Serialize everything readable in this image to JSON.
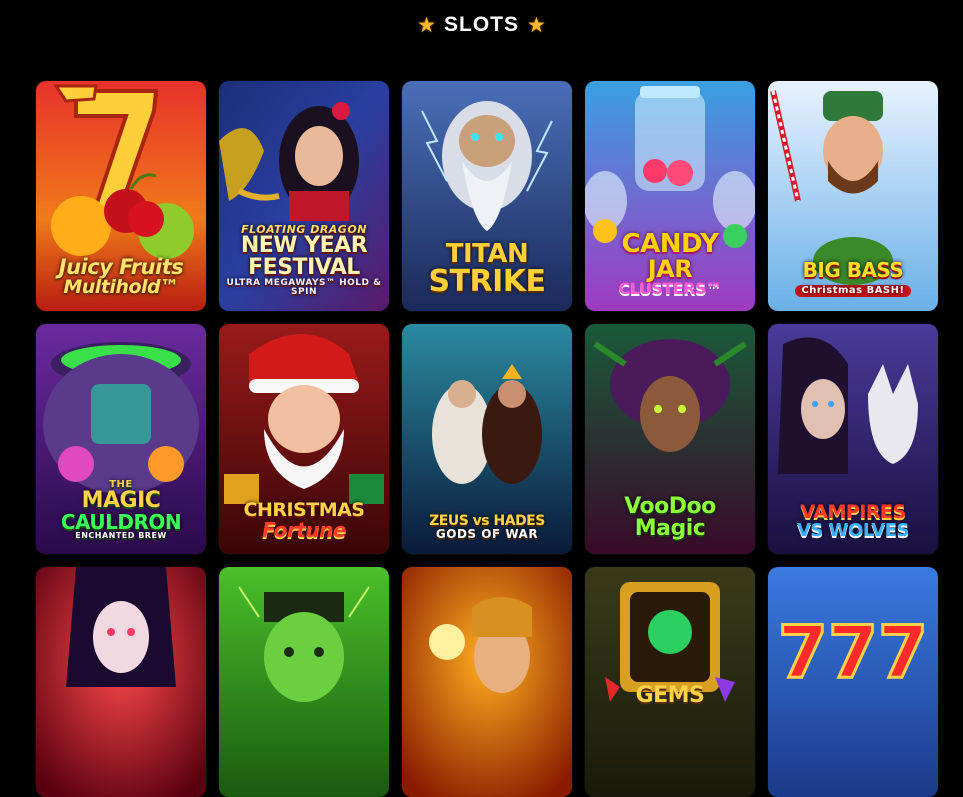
{
  "header": {
    "title": "SLOTS",
    "star_color": "#f5b731"
  },
  "games": [
    {
      "name": "juicy-fruits-multihold",
      "logo": [
        "",
        "Juicy Fruits",
        "Multihold™",
        ""
      ]
    },
    {
      "name": "floating-dragon-new-year-festival",
      "logo": [
        "FLOATING DRAGON",
        "NEW YEAR",
        "FESTIVAL",
        "ULTRA MEGAWAYS™ HOLD & SPIN"
      ]
    },
    {
      "name": "titan-strike",
      "logo": [
        "",
        "TITAN",
        "STRIKE",
        ""
      ]
    },
    {
      "name": "candy-jar-clusters",
      "logo": [
        "",
        "CANDY",
        "JAR",
        "CLUSTERS™"
      ]
    },
    {
      "name": "big-bass-christmas-bash",
      "logo": [
        "",
        "BIG BASS",
        "",
        "Christmas BASH!"
      ]
    },
    {
      "name": "the-magic-cauldron",
      "logo": [
        "THE",
        "MAGIC",
        "CAULDRON",
        "ENCHANTED BREW"
      ]
    },
    {
      "name": "christmas-fortune",
      "logo": [
        "",
        "CHRISTMAS",
        "Fortune",
        ""
      ]
    },
    {
      "name": "zeus-vs-hades",
      "logo": [
        "",
        "ZEUS vs HADES",
        "",
        "GODS OF WAR"
      ]
    },
    {
      "name": "voodoo-magic",
      "logo": [
        "",
        "VooDoo",
        "Magic",
        ""
      ]
    },
    {
      "name": "vampires-vs-wolves",
      "logo": [
        "",
        "VAMPIRES",
        "VS WOLVES",
        ""
      ]
    },
    {
      "name": "vampy-party",
      "logo": [
        "",
        "",
        "",
        ""
      ]
    },
    {
      "name": "frankenstein-slot",
      "logo": [
        "",
        "",
        "",
        ""
      ]
    },
    {
      "name": "fire-goddess-slot",
      "logo": [
        "",
        "",
        "",
        ""
      ]
    },
    {
      "name": "gems-slot",
      "logo": [
        "",
        "",
        "GEMS",
        ""
      ]
    },
    {
      "name": "777-slot",
      "logo": [
        "",
        "",
        "",
        ""
      ]
    }
  ]
}
